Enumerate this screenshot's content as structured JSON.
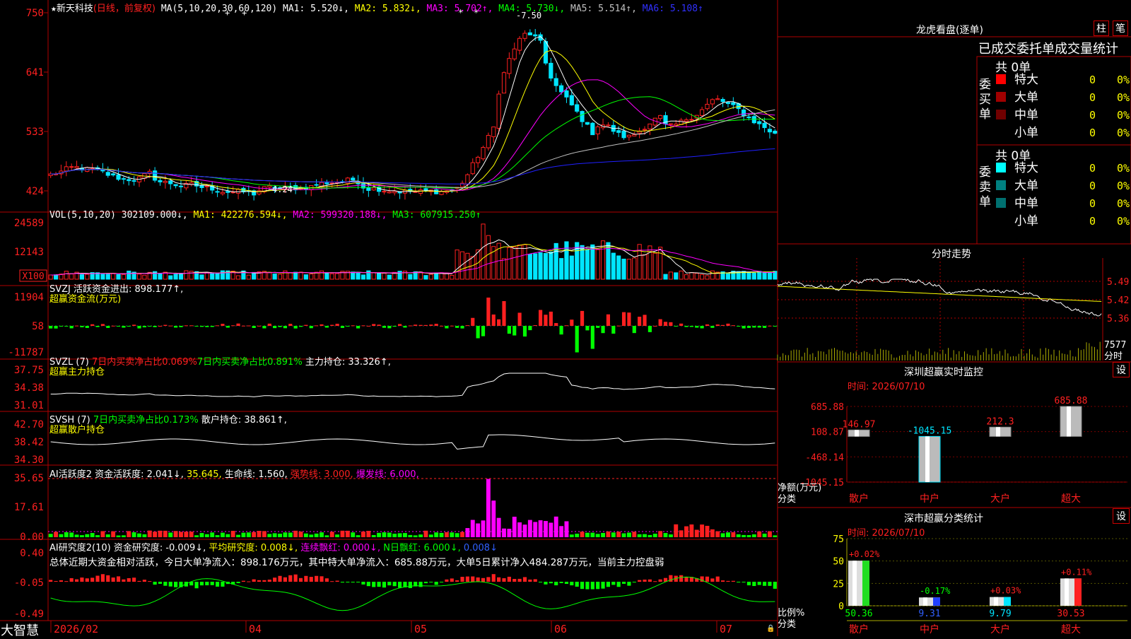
{
  "app": {
    "logo": "大智慧"
  },
  "colors": {
    "up": "#ff2020",
    "down": "#00e5ff",
    "grid": "#b00000",
    "white": "#ffffff",
    "yellow": "#ffff00",
    "magenta": "#ff00ff",
    "green": "#00ff00",
    "blue": "#2020ff",
    "gray": "#c0c0c0"
  },
  "price_panel": {
    "star": "★",
    "stock_name": "新天科技",
    "mode": "(日线，前复权)",
    "ma_label": "MA(5,10,20,30,60,120)",
    "ma1": "MA1: 5.520↓,",
    "ma2": "MA2: 5.832↓,",
    "ma3": "MA3: 5.702↑,",
    "ma4": "MA4: 5.730↓,",
    "ma5": "MA5: 5.514↑,",
    "ma6": "MA6: 5.108↑",
    "high_label": "7.50",
    "low_label": "4.24",
    "y_ticks": [
      "750",
      "641",
      "533",
      "424"
    ]
  },
  "vol_panel": {
    "title": "VOL(5,10,20)",
    "value": "302109.000↓,",
    "ma1": "MA1: 422276.594↓,",
    "ma2": "MA2: 599320.188↓,",
    "ma3": "MA3: 607915.250↑",
    "y_ticks": [
      "24589",
      "12143"
    ],
    "unit": "X100"
  },
  "svzj_panel": {
    "title": "SVZJ  活跃资金进出: 898.177↑,",
    "subtitle": "超赢资金流(万元)",
    "y_ticks": [
      "11904",
      "58",
      "-11787"
    ]
  },
  "svzl_panel": {
    "title": "SVZL (7)",
    "t1": "7日内买卖净占比0.069%",
    "t2": "7日内买卖净占比0.891%",
    "t3": "主力持仓: 33.326↑,",
    "subtitle": "超赢主力持仓",
    "y_ticks": [
      "37.75",
      "34.38",
      "31.01"
    ]
  },
  "svsh_panel": {
    "title": "SVSH (7)",
    "t1": "7日内买卖净占比0.173%",
    "t2": "散户持仓: 38.861↑,",
    "subtitle": "超赢散户持仓",
    "y_ticks": [
      "42.70",
      "38.42",
      "34.30"
    ]
  },
  "ai2_panel": {
    "title": "AI活跃度2",
    "t1": "资金活跃度: 2.041↓,",
    "t2": "35.645,",
    "t3": "生命线: 1.560,",
    "t4": "强势线: 3.000,",
    "t5": "爆发线: 6.000,",
    "y_ticks": [
      "35.65",
      "17.61",
      "0.00"
    ]
  },
  "ai_research_panel": {
    "title": "AI研究度2(10)",
    "t1": "资金研究度: -0.009↓,",
    "t2": "平均研究度: 0.008↓,",
    "t3": "连续飘红: 0.000↓,",
    "t4": "N日飘红: 6.000↓,",
    "t5": "0.008↓",
    "summary": "总体近期大资金相对活跃，今日大单净流入：898.176万元，其中特大单净流入：685.88万元，大单5日累计净入484.287万元，当前主力控盘弱",
    "y_ticks": [
      "0.40",
      "-0.05",
      "-0.49"
    ]
  },
  "x_axis": [
    "2026/02",
    "04",
    "05",
    "06",
    "07"
  ],
  "right_panel": {
    "longhu_title": "龙虎看盘(逐单)",
    "btn_zhu": "柱",
    "btn_bi": "笔",
    "tabs": "已成交委托单成交量统计",
    "buy": {
      "side_label": "委买单",
      "count": "共 0单",
      "rows": [
        {
          "name": "特大",
          "v": "0",
          "p": "0%"
        },
        {
          "name": "大单",
          "v": "0",
          "p": "0%"
        },
        {
          "name": "中单",
          "v": "0",
          "p": "0%"
        },
        {
          "name": "小单",
          "v": "0",
          "p": "0%"
        }
      ]
    },
    "sell": {
      "side_label": "委卖单",
      "count": "共 0单",
      "rows": [
        {
          "name": "特大",
          "v": "0",
          "p": "0%"
        },
        {
          "name": "大单",
          "v": "0",
          "p": "0%"
        },
        {
          "name": "中单",
          "v": "0",
          "p": "0%"
        },
        {
          "name": "小单",
          "v": "0",
          "p": "0%"
        }
      ]
    },
    "intraday_title": "分时走势",
    "intraday_ticks": [
      "5.49",
      "5.42",
      "5.36"
    ],
    "intraday_vol": "7577",
    "intraday_unit": "分时",
    "sz_monitor_title": "深圳超赢实时监控",
    "settings": "设",
    "sz_date": "时间: 2026/07/10",
    "sz_yticks": [
      "685.88",
      "108.87",
      "-468.14",
      "-1045.15"
    ],
    "sz_unit1": "净额(万元)",
    "sz_unit2": "分类",
    "sz_cats": [
      "散户",
      "中户",
      "大户",
      "超大"
    ],
    "sz_values": [
      146.97,
      -1045.15,
      212.3,
      685.88
    ],
    "sz_value_labels": [
      "146.97",
      "-1045.15",
      "212.3",
      "685.88"
    ],
    "sc_title": "深市超赢分类统计",
    "sc_date": "时间: 2026/07/10",
    "sc_yticks": [
      "75",
      "50",
      "25",
      "0"
    ],
    "sc_unit1": "比例%",
    "sc_unit2": "分类",
    "sc_cats": [
      "散户",
      "中户",
      "大户",
      "超大"
    ],
    "sc_values": [
      50.36,
      9.31,
      9.79,
      30.53
    ],
    "sc_value_labels": [
      "50.36",
      "9.31",
      "9.79",
      "30.53"
    ],
    "sc_changes": [
      "+0.02%",
      "-0.17%",
      "+0.03%",
      "+0.11%"
    ]
  },
  "chart_data": [
    {
      "type": "bar",
      "title": "深圳超赢实时监控",
      "ylabel": "净额(万元)",
      "categories": [
        "散户",
        "中户",
        "大户",
        "超大"
      ],
      "values": [
        146.97,
        -1045.15,
        212.3,
        685.88
      ],
      "ylim": [
        -1045.15,
        685.88
      ]
    },
    {
      "type": "bar",
      "title": "深市超赢分类统计",
      "ylabel": "比例%",
      "categories": [
        "散户",
        "中户",
        "大户",
        "超大"
      ],
      "values": [
        50.36,
        9.31,
        9.79,
        30.53
      ],
      "ylim": [
        0,
        75
      ]
    }
  ]
}
